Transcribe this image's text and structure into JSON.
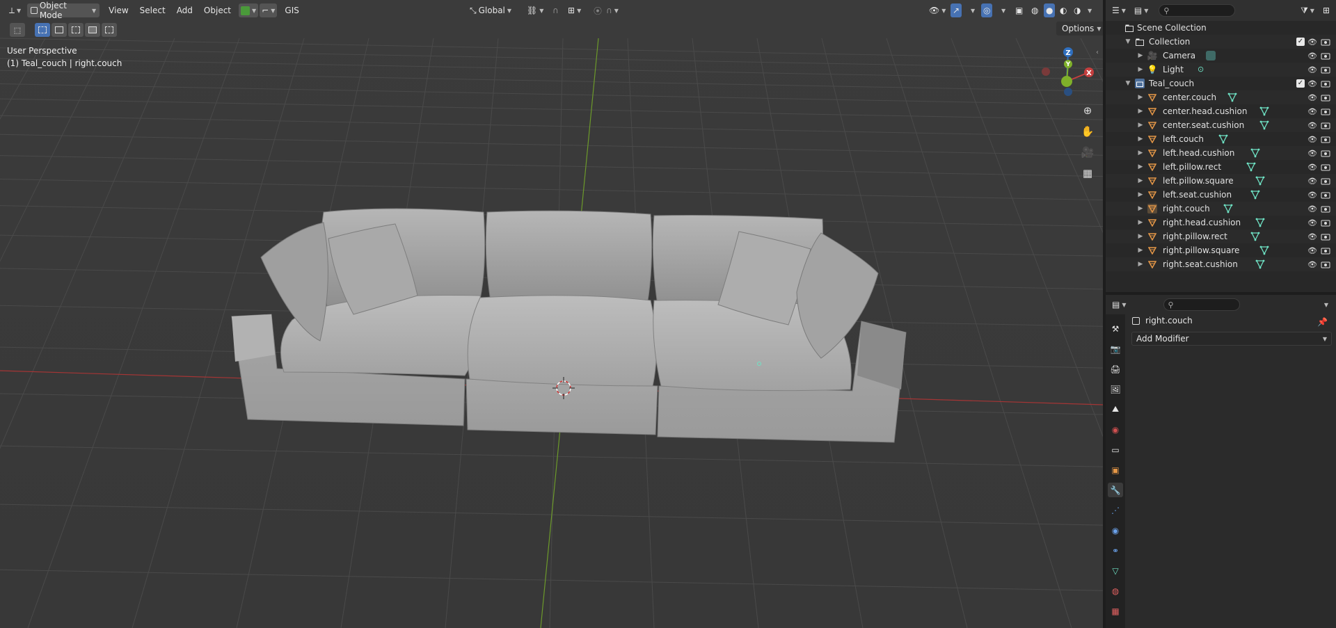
{
  "viewport_header": {
    "mode": "Object Mode",
    "menus": [
      "View",
      "Select",
      "Add",
      "Object"
    ],
    "gis": "GIS",
    "orientation": "Global",
    "options": "Options"
  },
  "viewport_info": {
    "perspective": "User Perspective",
    "active": "(1) Teal_couch | right.couch"
  },
  "gizmo": {
    "z": "Z",
    "y": "Y",
    "x": "X"
  },
  "outliner": {
    "scene_collection": "Scene Collection",
    "collection": "Collection",
    "camera": "Camera",
    "light": "Light",
    "teal_couch": "Teal_couch",
    "objects": [
      "center.couch",
      "center.head.cushion",
      "center.seat.cushion",
      "left.couch",
      "left.head.cushion",
      "left.pillow.rect",
      "left.pillow.square",
      "left.seat.cushion",
      "right.couch",
      "right.head.cushion",
      "right.pillow.rect",
      "right.pillow.square",
      "right.seat.cushion"
    ],
    "selected": "right.couch"
  },
  "properties": {
    "object_name": "right.couch",
    "add_modifier": "Add Modifier",
    "active_tab": "modifiers"
  },
  "colors": {
    "accent": "#4772b3",
    "x_axis": "#ff3352",
    "y_axis": "#8bdc00",
    "z_axis": "#2890ff",
    "mesh_icon": "#e59747",
    "mesh_data_icon": "#6fe3c5"
  }
}
